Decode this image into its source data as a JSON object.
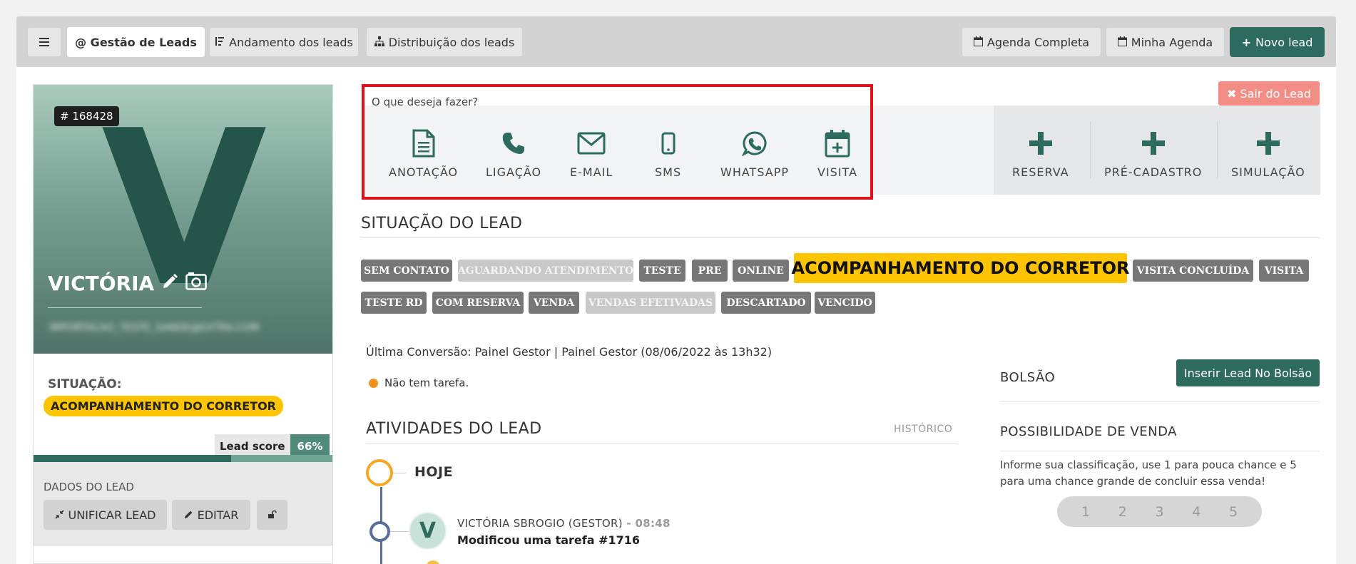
{
  "topbar": {
    "menu_icon": "hamburger-icon",
    "tabs": [
      {
        "label": "@ Gestão de Leads",
        "active": true
      },
      {
        "label": "Andamento dos leads",
        "icon": "sort-icon"
      },
      {
        "label": "Distribuição dos leads",
        "icon": "sitemap-icon"
      }
    ],
    "agenda_completa": "Agenda Completa",
    "minha_agenda": "Minha Agenda",
    "novo_lead": "Novo lead"
  },
  "lead": {
    "id": "# 168428",
    "initial": "V",
    "name": "VICTÓRIA",
    "email": "IMPORTACAO_TESTE_SANDE@EXTRA.COM",
    "situacao_label": "SITUAÇÃO:",
    "situacao_value": "ACOMPANHAMENTO DO CORRETOR",
    "score_label": "Lead score",
    "score_value": "66%",
    "score_fraction": 0.66,
    "dados_title": "DADOS DO LEAD",
    "unificar": "UNIFICAR LEAD",
    "editar": "EDITAR"
  },
  "actions": {
    "prompt": "O que deseja fazer?",
    "items": [
      "ANOTAÇÃO",
      "LIGAÇÃO",
      "E-MAIL",
      "SMS",
      "WHATSAPP",
      "VISITA"
    ],
    "extra": [
      "RESERVA",
      "PRÉ-CADASTRO",
      "SIMULAÇÃO"
    ],
    "sair": "Sair do Lead"
  },
  "situacao": {
    "title": "SITUAÇÃO DO LEAD",
    "tags_row1": [
      "SEM CONTATO",
      "AGUARDANDO ATENDIMENTO",
      "TESTE",
      "PRE",
      "ONLINE",
      "ACOMPANHAMENTO DO CORRETOR",
      "VISITA CONCLUÍDA",
      "VISITA"
    ],
    "tags_row2": [
      "TESTE RD",
      "COM RESERVA",
      "VENDA",
      "VENDAS EFETIVADAS",
      "DESCARTADO",
      "VENCIDO"
    ],
    "conversao": "Última Conversão: Painel Gestor | Painel Gestor (08/06/2022 às 13h32)",
    "sem_tarefa": "Não tem tarefa."
  },
  "atividades": {
    "title": "ATIVIDADES DO LEAD",
    "historico": "HISTÓRICO",
    "today": "HOJE",
    "entry_initial": "V",
    "entry_who": "VICTÓRIA SBROGIO (GESTOR)",
    "entry_sep": " - ",
    "entry_time": "08:48",
    "entry_what": "Modificou uma tarefa #1716"
  },
  "right": {
    "bolsao_title": "BOLSÃO",
    "bolsao_button": "Inserir Lead No Bolsão",
    "possibilidade_title": "POSSIBILIDADE DE VENDA",
    "possibilidade_desc": "Informe sua classificação, use 1 para pouca chance e 5 para uma chance grande de concluir essa venda!",
    "rating": [
      "1",
      "2",
      "3",
      "4",
      "5"
    ]
  },
  "colors": {
    "primary": "#2d6b5e",
    "highlight": "#ffc400",
    "danger_border": "#e3101a",
    "sair": "#f28d85"
  }
}
